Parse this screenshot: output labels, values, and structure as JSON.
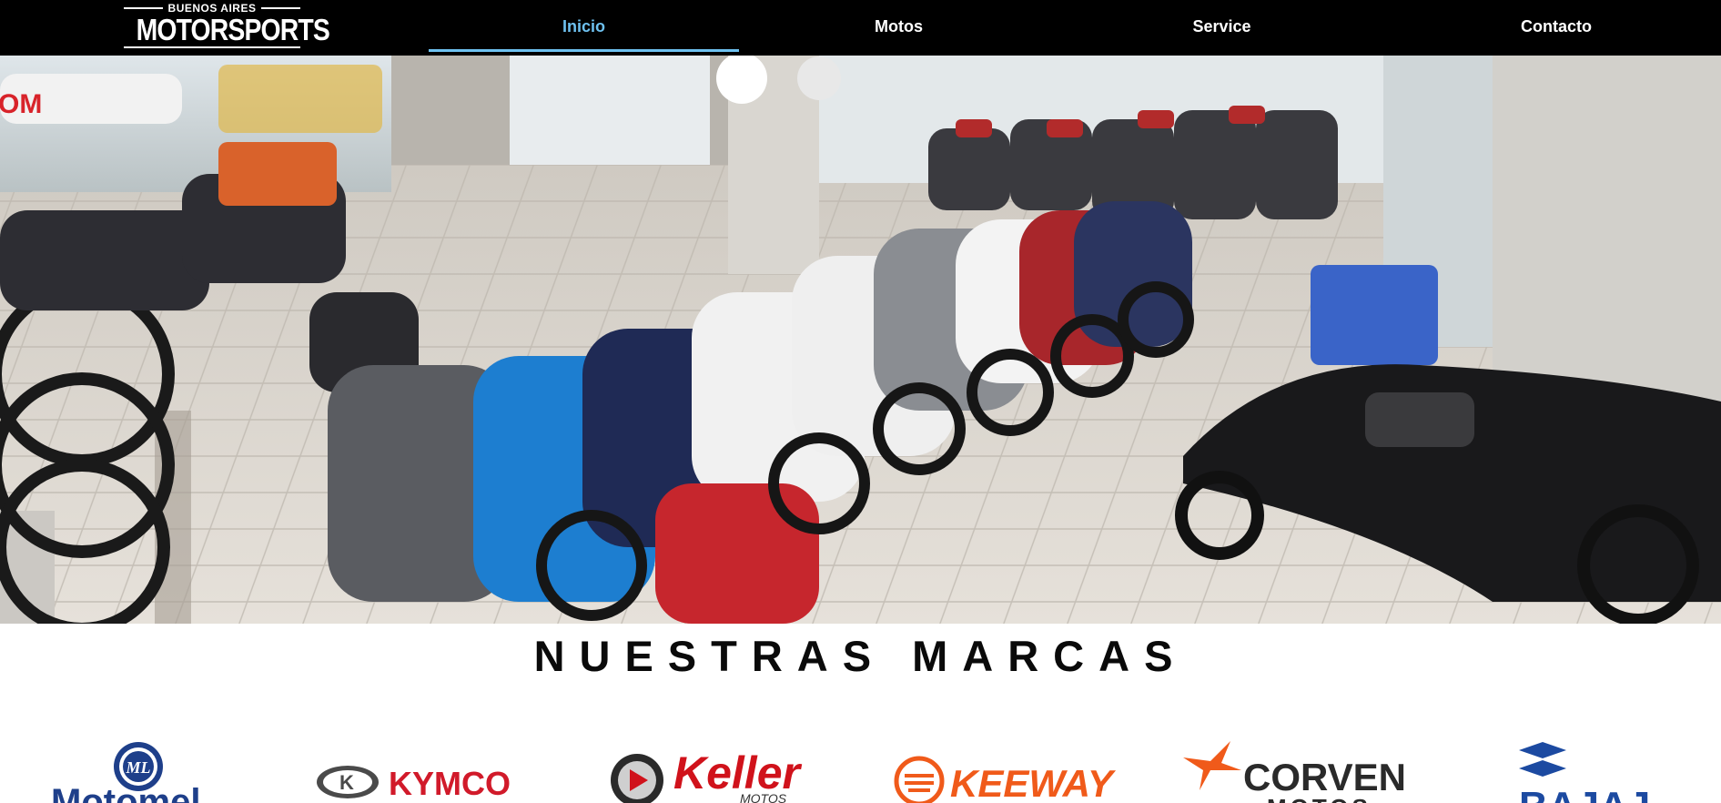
{
  "header": {
    "logo": {
      "top_text": "BUENOS AIRES",
      "main_text": "MOTORSPORTS"
    },
    "nav": [
      {
        "label": "Inicio",
        "active": true
      },
      {
        "label": "Motos",
        "active": false
      },
      {
        "label": "Service",
        "active": false
      },
      {
        "label": "Contacto",
        "active": false
      }
    ]
  },
  "hero": {
    "description": "showroom-photo"
  },
  "brands": {
    "title": "NUESTRAS MARCAS",
    "items": [
      {
        "name": "Motomel",
        "visible_text": "Motomel",
        "color": "#1e3f8a"
      },
      {
        "name": "Kymco",
        "visible_text": "KYMCO",
        "color": "#d11a2a"
      },
      {
        "name": "Keller",
        "visible_text": "Keller",
        "sub_text": "MOTOS",
        "color": "#d0121b"
      },
      {
        "name": "Keeway",
        "visible_text": "KEEWAY",
        "color": "#f05a1a"
      },
      {
        "name": "Corven",
        "visible_text": "CORVEN",
        "sub_text": "MOTOS",
        "color": "#2a2a2a"
      },
      {
        "name": "Bajaj",
        "visible_text": "BAJAJ",
        "color": "#1c4aa1"
      }
    ]
  },
  "colors": {
    "nav_active": "#6ec1f0",
    "header_bg": "#000000",
    "nav_text": "#ffffff"
  }
}
